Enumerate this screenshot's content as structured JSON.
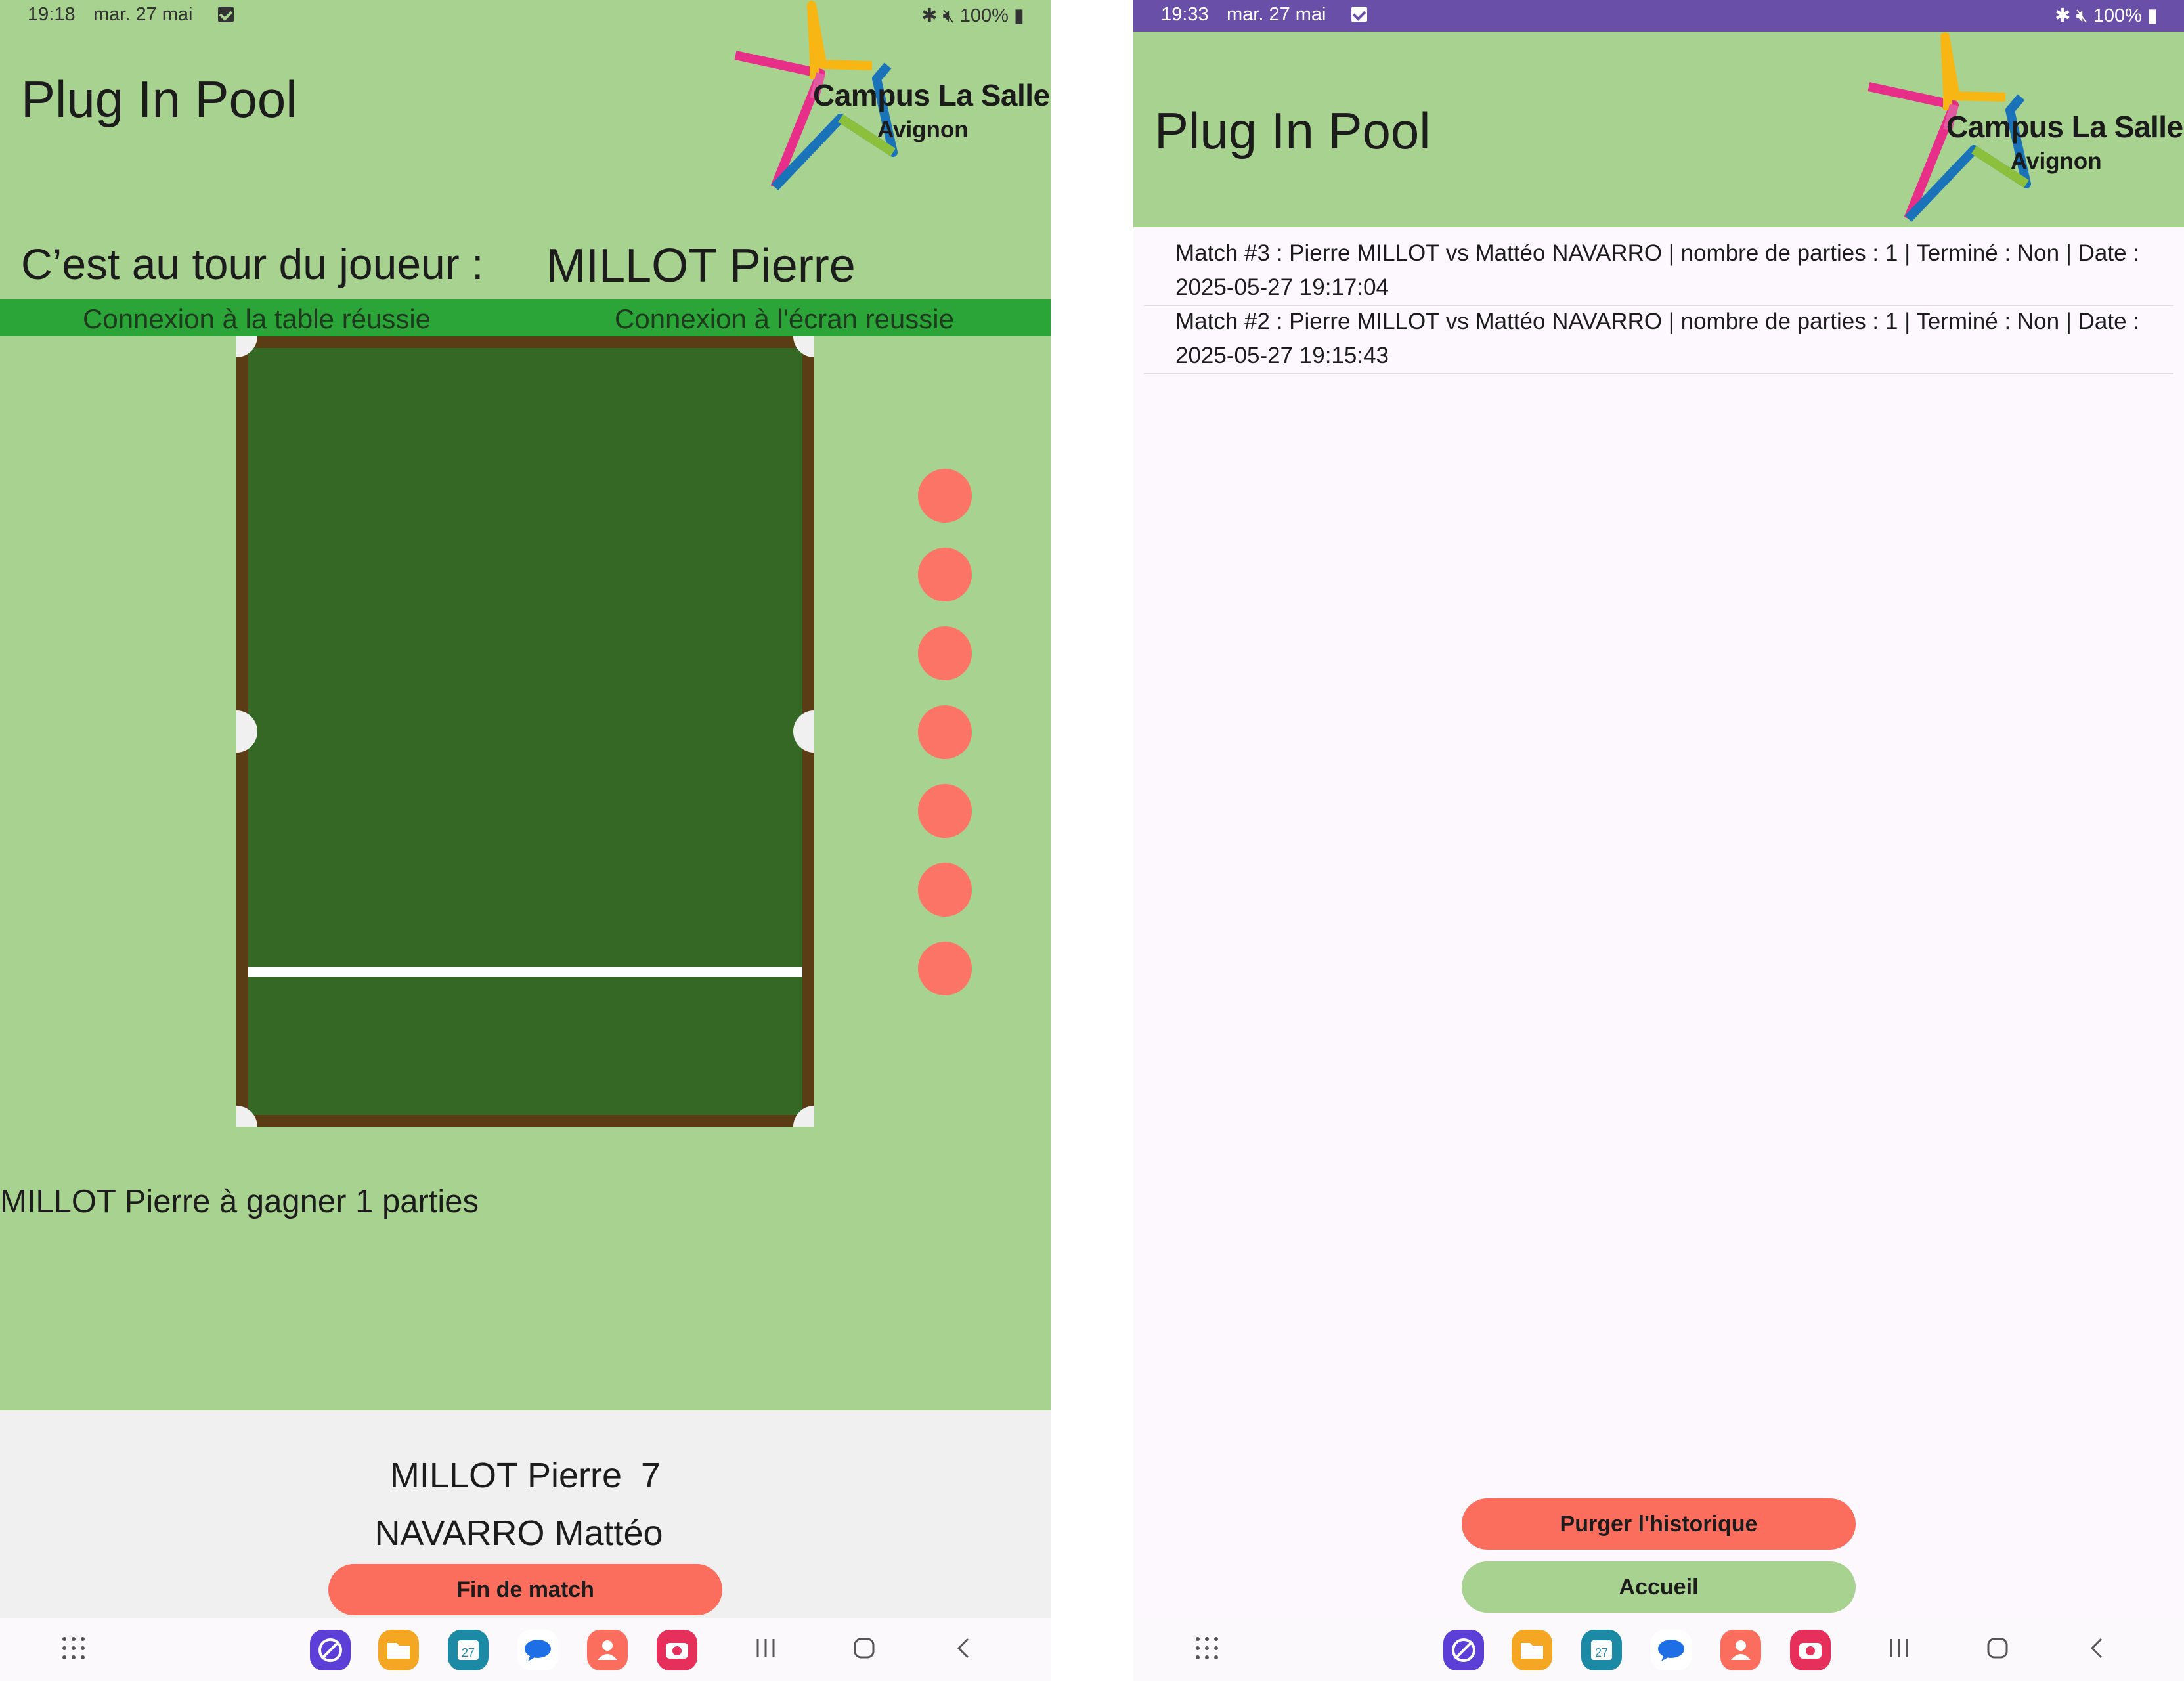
{
  "colors": {
    "accent_green": "#a8d28f",
    "connection_green": "#2ca538",
    "felt": "#356725",
    "rail": "#5a3d15",
    "ball": "#fb7466",
    "button_red": "#fb6d5d",
    "status_purple": "#6a4fa8"
  },
  "left": {
    "status": {
      "time": "19:18",
      "date": "mar. 27 mai",
      "battery": "100%",
      "icons": [
        "bluetooth-icon",
        "mute-icon",
        "battery-icon"
      ]
    },
    "app_title": "Plug In Pool",
    "logo": {
      "line1": "Campus La Salle",
      "line2": "Avignon"
    },
    "turn_label": "C’est au tour du joueur :",
    "turn_player": "MILLOT Pierre",
    "conn_table": "Connexion à la table réussie",
    "conn_screen": "Connexion à l'écran reussie",
    "balls_remaining": 7,
    "winner_text": "MILLOT Pierre à gagner 1 parties",
    "score": {
      "player1": "MILLOT Pierre",
      "player1_score": "7",
      "player2": "NAVARRO Mattéo",
      "player2_score": ""
    },
    "end_button": "Fin de match"
  },
  "right": {
    "status": {
      "time": "19:33",
      "date": "mar. 27 mai",
      "battery": "100%",
      "icons": [
        "bluetooth-icon",
        "mute-icon",
        "battery-charging-icon"
      ]
    },
    "app_title": "Plug In Pool",
    "logo": {
      "line1": "Campus La Salle",
      "line2": "Avignon"
    },
    "history": [
      {
        "line1": "Match #3 : Pierre MILLOT vs Mattéo NAVARRO | nombre de parties : 1 | Terminé : Non | Date :",
        "line2": "2025-05-27 19:17:04"
      },
      {
        "line1": "Match #2 : Pierre MILLOT vs Mattéo NAVARRO | nombre de parties : 1 | Terminé : Non | Date :",
        "line2": "2025-05-27 19:15:43"
      }
    ],
    "purge_button": "Purger l'historique",
    "home_button": "Accueil"
  },
  "nav_apps": [
    "internet-icon",
    "my-files-icon",
    "calendar-icon",
    "messages-icon",
    "contacts-icon",
    "camera-icon"
  ],
  "calendar_day": "27"
}
